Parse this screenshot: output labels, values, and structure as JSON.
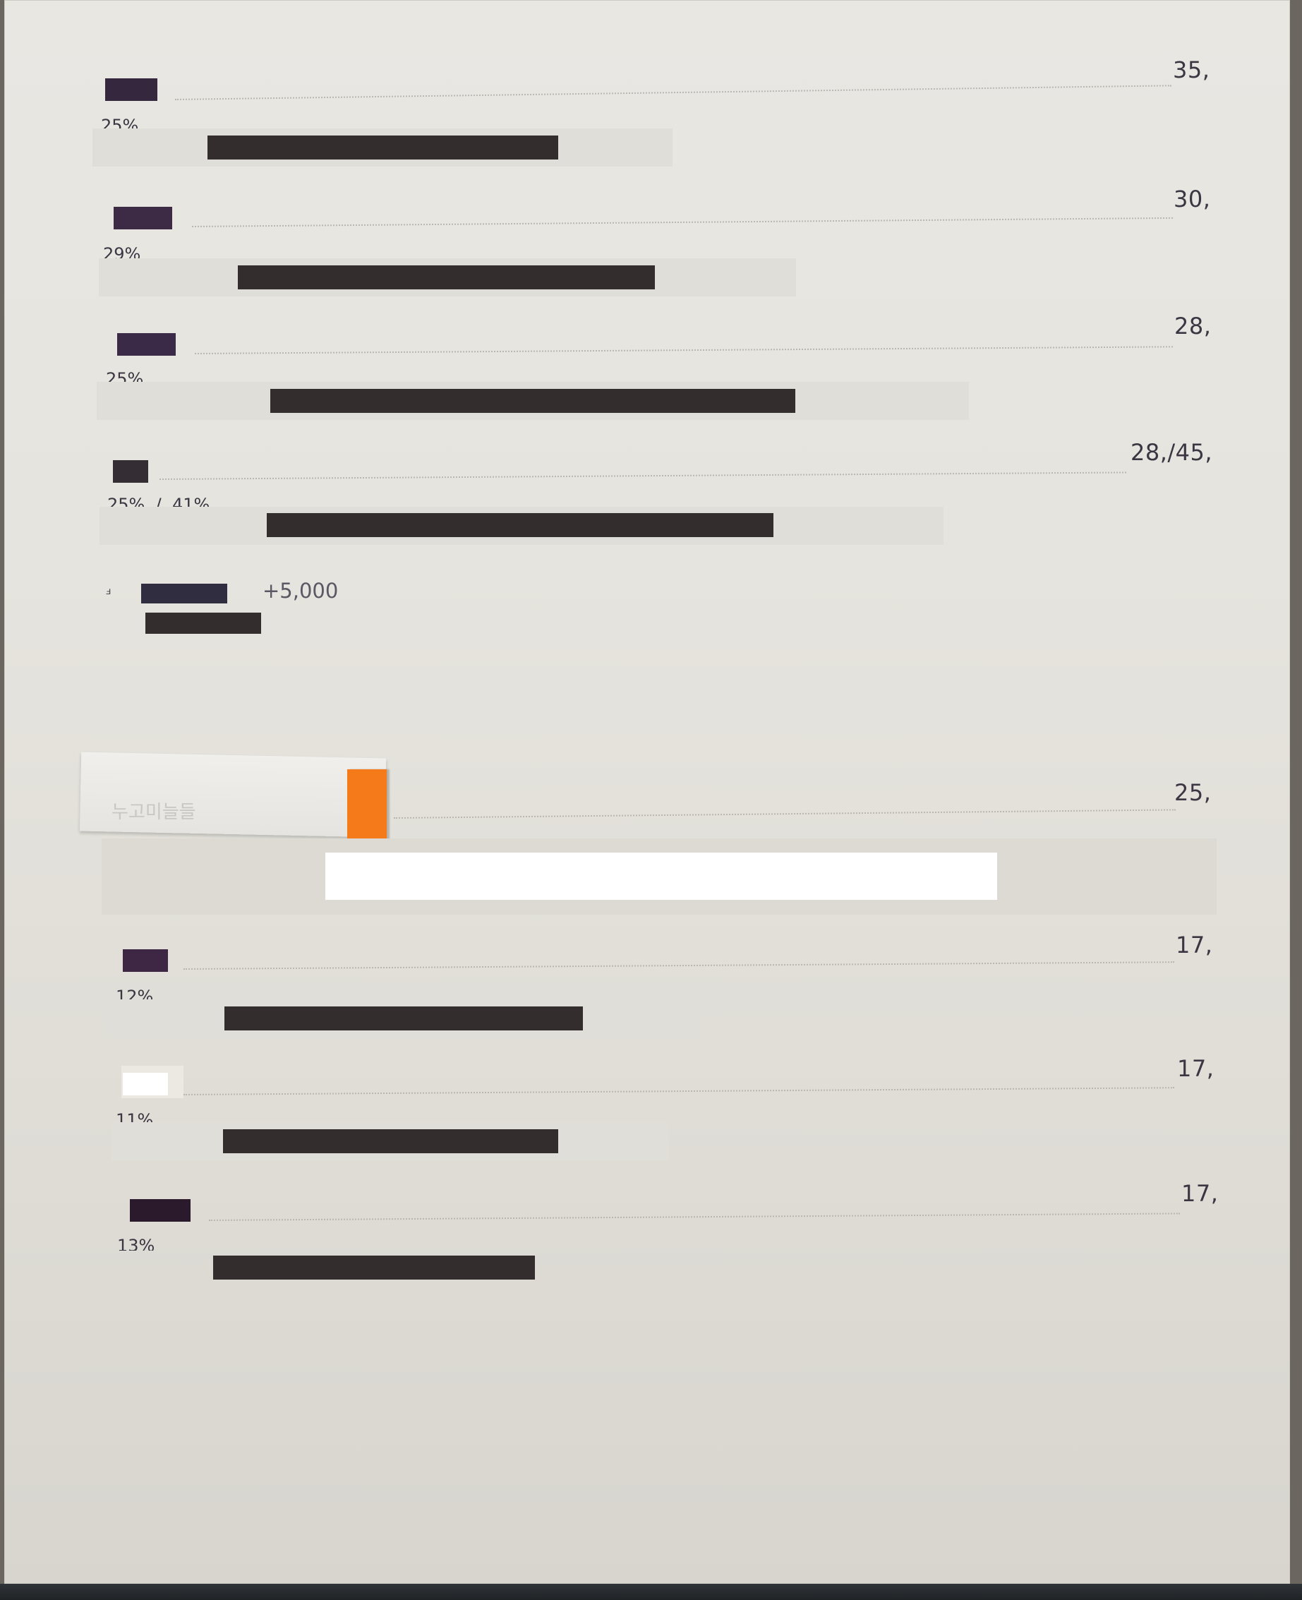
{
  "entries": [
    {
      "value": "35,",
      "pct": "25%",
      "colors": {
        "swatch": "#35283e",
        "bar": "#332d2d"
      }
    },
    {
      "value": "30,",
      "pct": "29%",
      "colors": {
        "swatch": "#3d2a45",
        "bar": "#332d2d"
      }
    },
    {
      "value": "28,",
      "pct": "25%",
      "colors": {
        "swatch": "#3b2a47",
        "bar": "#332d2d"
      }
    },
    {
      "value": "28,/45,",
      "pct": "25%  /  41%",
      "colors": {
        "swatch": "#342d33",
        "bar": "#332d2d"
      }
    },
    {
      "value": "25,",
      "pct": "",
      "colors": {
        "swatch": "#f47a1a",
        "bar": "#ffffff"
      }
    },
    {
      "value": "17,",
      "pct": "12%",
      "colors": {
        "swatch": "#3e2645",
        "bar": "#332d2d"
      }
    },
    {
      "value": "17,",
      "pct": "11%",
      "colors": {
        "swatch": "#ffffff",
        "bar": "#332d2d"
      }
    },
    {
      "value": "17,",
      "pct": "13%",
      "colors": {
        "swatch": "#2a1a2c",
        "bar": "#332d2d"
      }
    }
  ],
  "note": {
    "prefix": "ⅎ",
    "value": "+5,000",
    "colors": {
      "swatch": "#2f2d3f",
      "bar": "#332d2d"
    }
  },
  "sticky": {
    "text": "누고미늘들",
    "tab_color": "#f47a1a"
  },
  "colors": {
    "paper": "#e7e5e0",
    "leader": "#b8b6b0",
    "text": "#3c3643"
  }
}
